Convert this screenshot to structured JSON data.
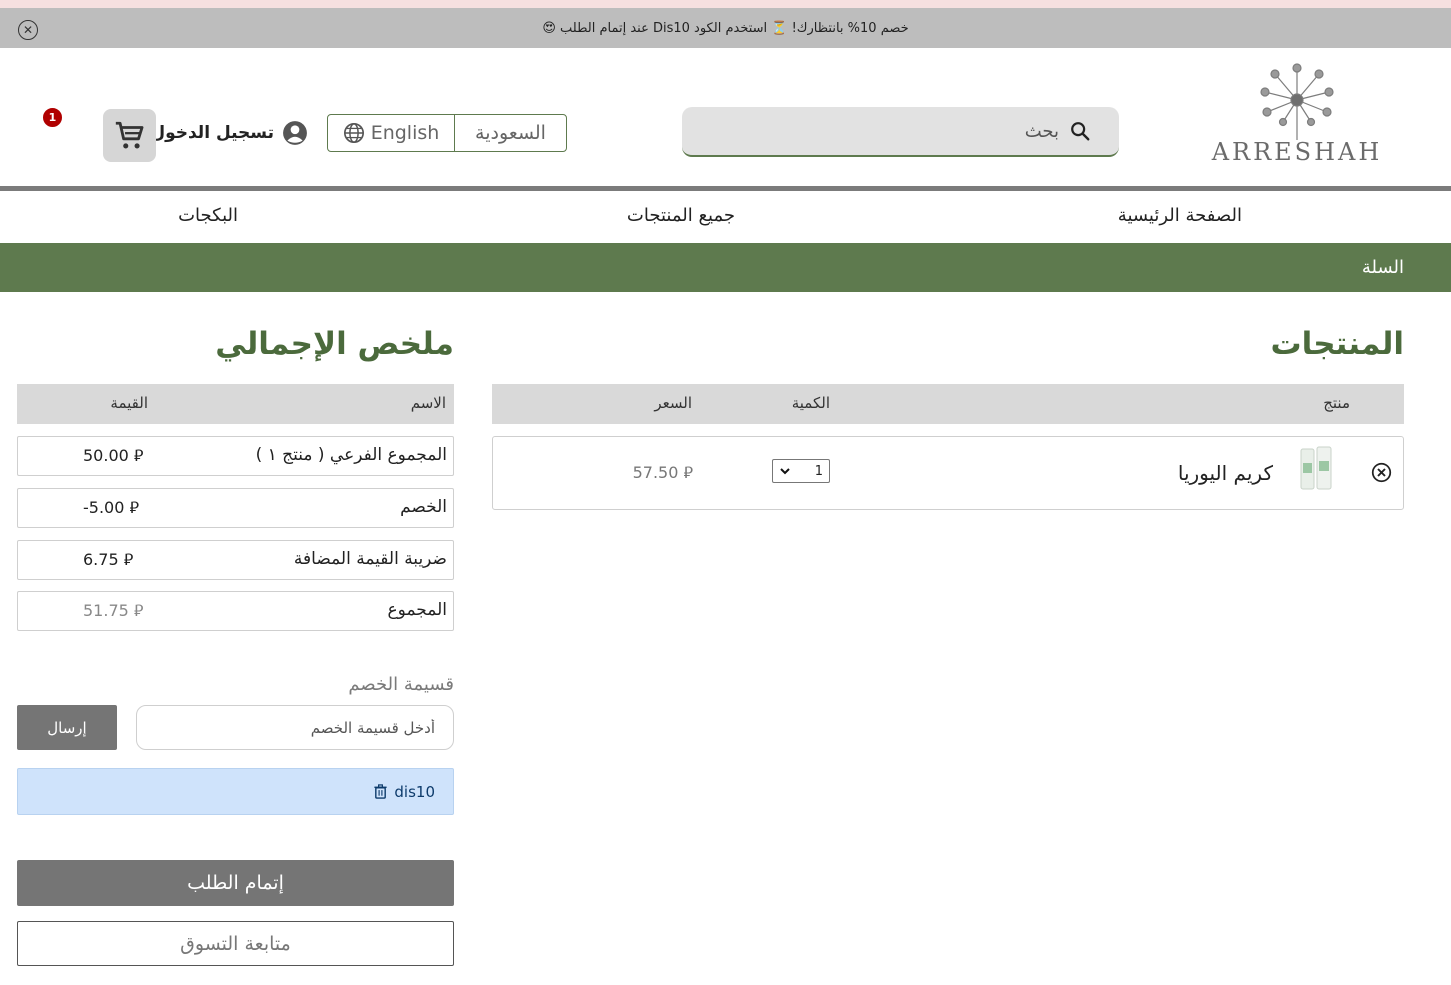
{
  "announcement": {
    "text": "خصم 10% بانتظارك! ⏳ استخدم الكود Dis10 عند إتمام الطلب 😍"
  },
  "header": {
    "logo_text": "ARRESHAH",
    "search_placeholder": "بحث",
    "country": "السعودية",
    "language": "English",
    "login_label": "تسجيل الدخول",
    "cart_count": "1"
  },
  "nav": {
    "home": "الصفحة الرئيسية",
    "all_products": "جميع المنتجات",
    "bundles": "البكجات"
  },
  "breadcrumb": "السلة",
  "products": {
    "title": "المنتجات",
    "columns": {
      "product": "منتج",
      "quantity": "الكمية",
      "price": "السعر"
    },
    "items": [
      {
        "name": "كريم اليوريا",
        "quantity": "1",
        "price": "57.50 ⃁"
      }
    ]
  },
  "summary": {
    "title": "ملخص الإجمالي",
    "columns": {
      "name": "الاسم",
      "value": "القيمة"
    },
    "rows": [
      {
        "label": "المجموع الفرعي ( منتج ١ )",
        "value": "50.00 ⃁"
      },
      {
        "label": "الخصم",
        "value": "-5.00 ⃁"
      },
      {
        "label": "ضريبة القيمة المضافة",
        "value": "6.75 ⃁"
      },
      {
        "label": "المجموع",
        "value": "51.75 ⃁"
      }
    ]
  },
  "coupon": {
    "title": "قسيمة الخصم",
    "placeholder": "أدخل قسيمة الخصم",
    "send_label": "إرسال",
    "applied_code": "dis10"
  },
  "actions": {
    "checkout": "إتمام الطلب",
    "continue": "متابعة التسوق"
  },
  "colors": {
    "brand_green": "#5e7a4e",
    "badge_red": "#b00000",
    "button_gray": "#757575",
    "applied_blue": "#cfe3fb"
  }
}
